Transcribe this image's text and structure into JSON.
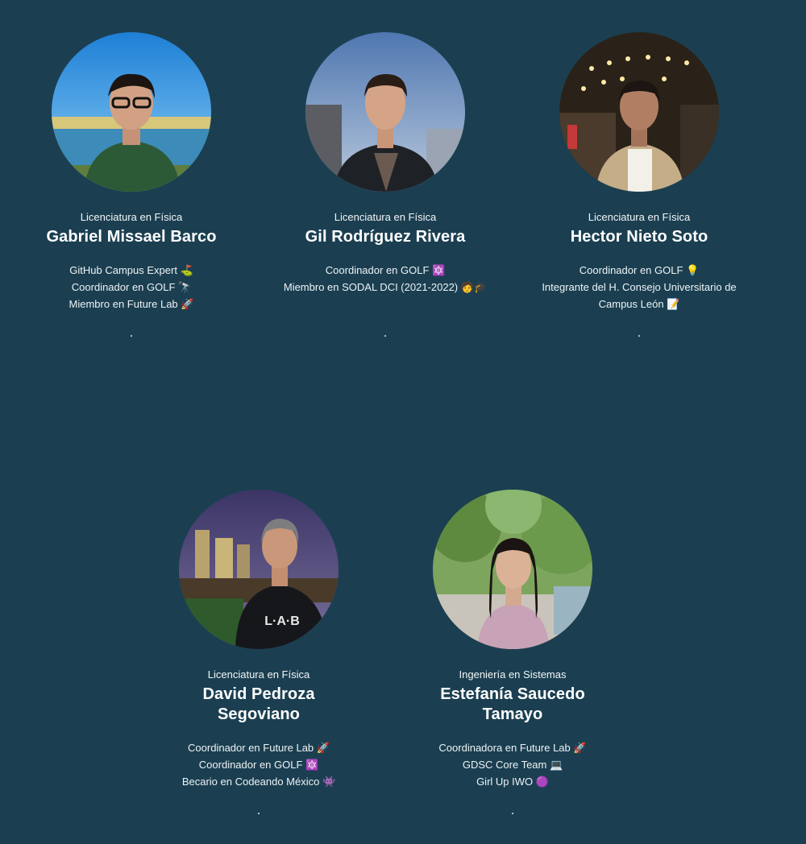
{
  "members": [
    {
      "degree": "Licenciatura en Física",
      "name": "Gabriel Missael Barco",
      "roles": [
        "GitHub Campus Expert ⛳",
        "Coordinador en GOLF 🔭",
        "Miembro en Future Lab 🚀"
      ],
      "dot": ".",
      "avatar_icon": "person-photo-icon"
    },
    {
      "degree": "Licenciatura en Física",
      "name": "Gil Rodríguez Rivera",
      "roles": [
        "Coordinador en GOLF 🔯",
        "Miembro en SODAL DCI (2021-2022) 🧑🎓"
      ],
      "dot": ".",
      "avatar_icon": "person-photo-icon"
    },
    {
      "degree": "Licenciatura en Física",
      "name": "Hector Nieto Soto",
      "roles": [
        "Coordinador en GOLF 💡",
        "Integrante del H. Consejo Universitario de Campus León 📝"
      ],
      "dot": ".",
      "avatar_icon": "person-photo-icon"
    },
    {
      "degree": "Licenciatura en Física",
      "name": "David Pedroza Segoviano",
      "roles": [
        "Coordinador en Future Lab 🚀",
        "Coordinador en GOLF 🔯",
        "Becario en Codeando México 👾"
      ],
      "dot": ".",
      "avatar_icon": "person-photo-icon"
    },
    {
      "degree": "Ingeniería en Sistemas",
      "name": "Estefanía Saucedo Tamayo",
      "roles": [
        "Coordinadora en Future Lab 🚀",
        "GDSC Core Team 💻",
        "Girl Up IWO 🟣"
      ],
      "dot": ".",
      "avatar_icon": "person-photo-icon"
    }
  ],
  "colors": {
    "background": "#1b3f51",
    "text": "#ffffff"
  }
}
